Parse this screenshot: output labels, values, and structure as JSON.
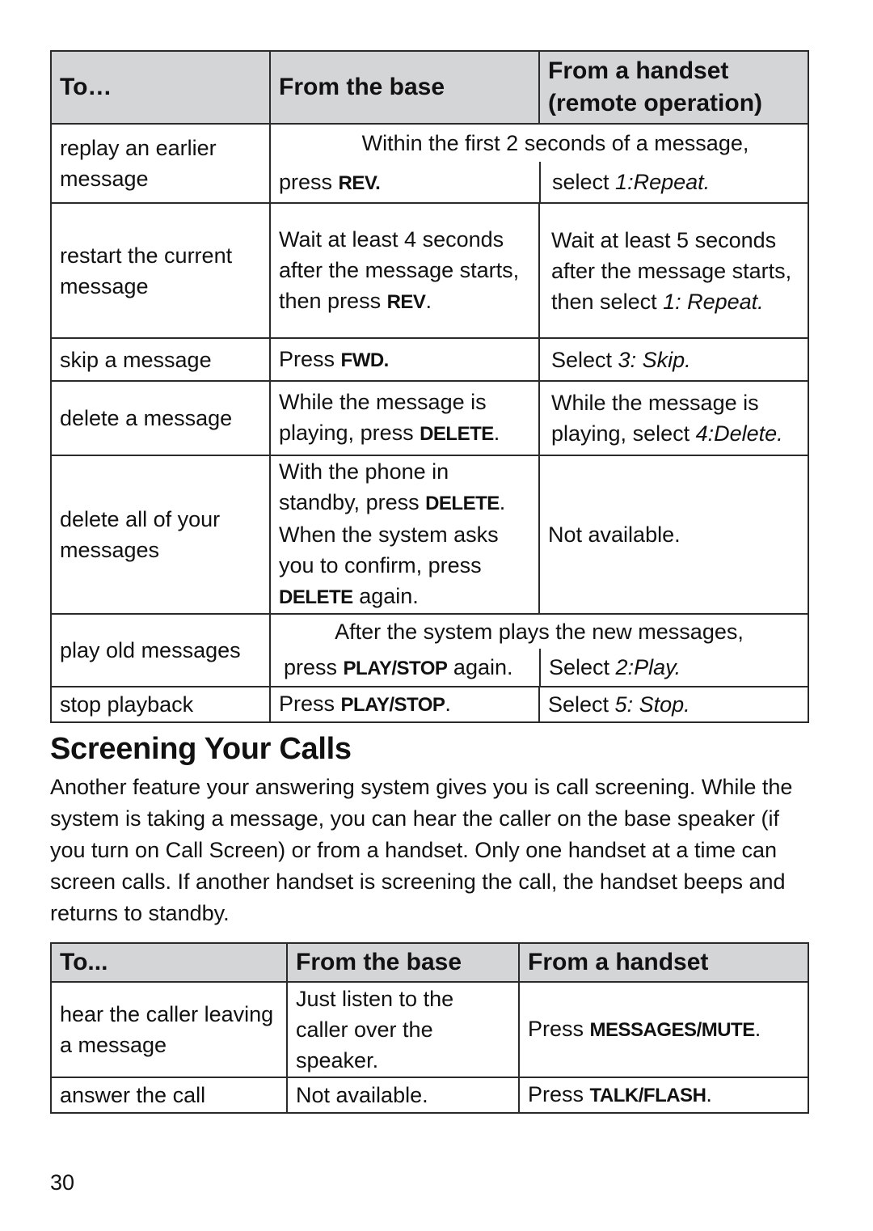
{
  "table1": {
    "headers": [
      "To…",
      "From the base",
      "From a handset (remote operation)"
    ],
    "rows": {
      "replay": {
        "action": "replay an earlier message",
        "shared": "Within the first 2 seconds of a message,",
        "base_pre": "press ",
        "base_key": "REV.",
        "handset_pre": "select ",
        "handset_it": "1:Repeat."
      },
      "restart": {
        "action": "restart the current message",
        "base_pre": "Wait at least 4 seconds after the message starts, then press ",
        "base_key": "REV",
        "base_post": ".",
        "handset_pre": "Wait at least 5 seconds after the message starts, then select ",
        "handset_it": "1: Repeat."
      },
      "skip": {
        "action": "skip a message",
        "base_pre": "Press ",
        "base_key": "FWD.",
        "handset_pre": "Select ",
        "handset_it": "3: Skip."
      },
      "delete": {
        "action": "delete a message",
        "base_pre": "While the message is playing, press ",
        "base_key": "DELETE",
        "base_post": ".",
        "handset_pre": "While the message is playing, select ",
        "handset_it": "4:Delete."
      },
      "delete_all": {
        "action": "delete all of your messages",
        "base_1": "With the phone in standby, press ",
        "base_key1": "DELETE",
        "base_2": ". When the system asks you to confirm, press ",
        "base_key2": "DELETE",
        "base_3": " again.",
        "handset": "Not available."
      },
      "play_old": {
        "action": "play old messages",
        "shared": "After the system plays the new messages,",
        "base_pre": "press ",
        "base_key": "PLAY/STOP",
        "base_post": " again.",
        "handset_pre": "Select ",
        "handset_it": "2:Play."
      },
      "stop": {
        "action": "stop playback",
        "base_pre": "Press ",
        "base_key": "PLAY/STOP",
        "base_post": ".",
        "handset_pre": "Select ",
        "handset_it": "5: Stop."
      }
    }
  },
  "section": {
    "title": "Screening Your Calls",
    "body": "Another feature your answering system gives you is call screening. While the system is taking a message, you can hear the caller on the base speaker (if you turn on Call Screen) or from a handset. Only one handset at a time can screen calls. If another handset is screening the call, the handset beeps and returns to standby."
  },
  "table2": {
    "headers": [
      "To...",
      "From the base",
      "From a handset"
    ],
    "rows": {
      "hear": {
        "action": "hear the caller leaving a message",
        "base": "Just listen to the caller over the speaker.",
        "handset_pre": "Press ",
        "handset_key": "MESSAGES/MUTE",
        "handset_post": "."
      },
      "answer": {
        "action": "answer the call",
        "base": "Not available.",
        "handset_pre": "Press ",
        "handset_key": "TALK/FLASH",
        "handset_post": "."
      }
    }
  },
  "page_number": "30"
}
